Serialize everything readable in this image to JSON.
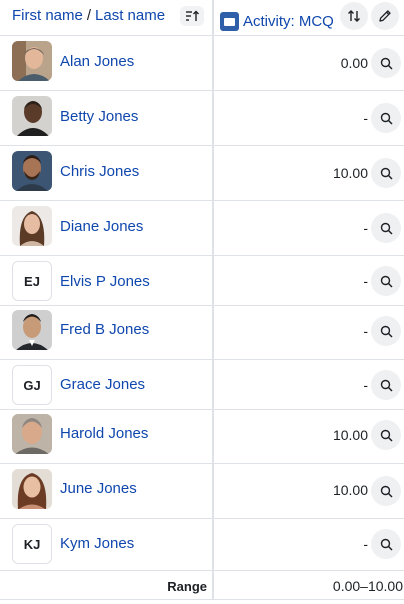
{
  "header": {
    "first_name": "First name",
    "separator": "/",
    "last_name": "Last name",
    "activity_label": "Activity: MCQ"
  },
  "students": [
    {
      "name": "Alan Jones",
      "grade": "0.00",
      "avatar": "photo"
    },
    {
      "name": "Betty Jones",
      "grade": "-",
      "avatar": "photo"
    },
    {
      "name": "Chris Jones",
      "grade": "10.00",
      "avatar": "photo"
    },
    {
      "name": "Diane Jones",
      "grade": "-",
      "avatar": "photo"
    },
    {
      "name": "Elvis P Jones",
      "grade": "-",
      "avatar": "initials",
      "initials": "EJ"
    },
    {
      "name": "Fred B Jones",
      "grade": "-",
      "avatar": "photo"
    },
    {
      "name": "Grace Jones",
      "grade": "-",
      "avatar": "initials",
      "initials": "GJ"
    },
    {
      "name": "Harold Jones",
      "grade": "10.00",
      "avatar": "photo"
    },
    {
      "name": "June Jones",
      "grade": "10.00",
      "avatar": "photo"
    },
    {
      "name": "Kym Jones",
      "grade": "-",
      "avatar": "initials",
      "initials": "KJ"
    }
  ],
  "footer": {
    "range_label": "Range",
    "range_value": "0.00–10.00"
  },
  "colors": {
    "link": "#0f47ad",
    "border": "#dee2e6",
    "button_bg": "#eef0f2",
    "activity_icon": "#2f5fa8"
  }
}
